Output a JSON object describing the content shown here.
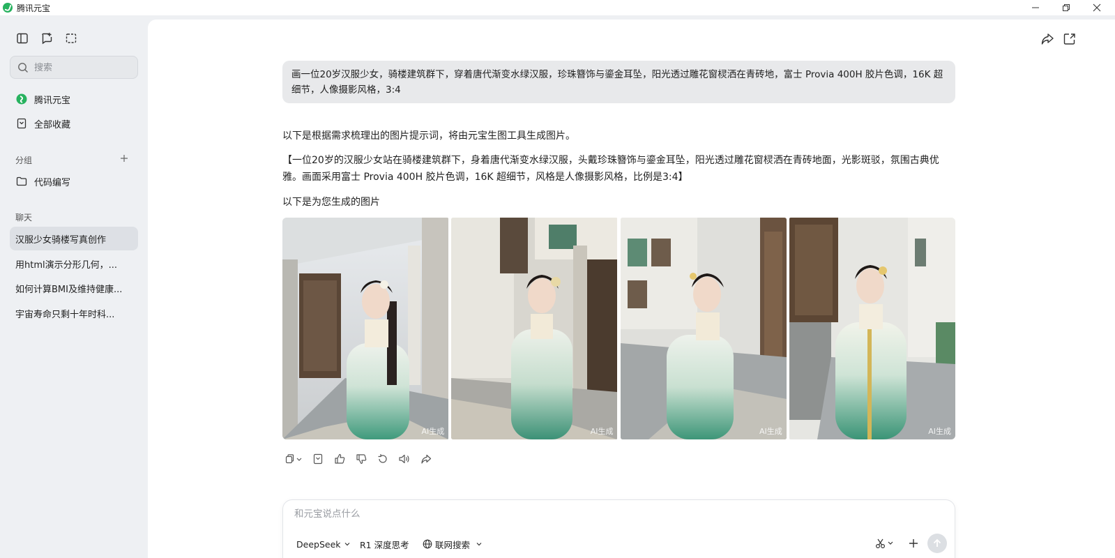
{
  "window": {
    "title": "腾讯元宝"
  },
  "sidebar": {
    "search_placeholder": "搜索",
    "nav": [
      {
        "label": "腾讯元宝",
        "icon": "yuanbao-logo-icon"
      },
      {
        "label": "全部收藏",
        "icon": "bookmark-icon"
      }
    ],
    "groups_label": "分组",
    "groups": [
      {
        "label": "代码编写",
        "icon": "folder-icon"
      }
    ],
    "chats_label": "聊天",
    "chats": [
      {
        "label": "汉服少女骑楼写真创作",
        "active": true
      },
      {
        "label": "用html演示分形几何，...",
        "active": false
      },
      {
        "label": "如何计算BMI及维持健康...",
        "active": false
      },
      {
        "label": "宇宙寿命只剩十年时科...",
        "active": false
      }
    ]
  },
  "conversation": {
    "user_message": "画一位20岁汉服少女，骑楼建筑群下，穿着唐代渐变水绿汉服，珍珠簪饰与鎏金耳坠，阳光透过雕花窗棂洒在青砖地，富士 Provia 400H 胶片色调，16K 超细节，人像摄影风格，3:4",
    "assistant": {
      "intro": "以下是根据需求梳理出的图片提示词，将由元宝生图工具生成图片。",
      "prompt": "【一位20岁的汉服少女站在骑楼建筑群下，身着唐代渐变水绿汉服，头戴珍珠簪饰与鎏金耳坠，阳光透过雕花窗棂洒在青砖地面，光影斑驳，氛围古典优雅。画面采用富士 Provia 400H 胶片色调，16K 超细节，风格是人像摄影风格，比例是3:4】",
      "generated_label": "以下是为您生成的图片",
      "images": [
        {
          "watermark": "AI生成"
        },
        {
          "watermark": "AI生成"
        },
        {
          "watermark": "AI生成"
        },
        {
          "watermark": "AI生成"
        }
      ]
    }
  },
  "composer": {
    "placeholder": "和元宝说点什么",
    "model": "DeepSeek",
    "deep_think": "R1 深度思考",
    "web_search": "联网搜索"
  },
  "colors": {
    "accent_green": "#27b25f",
    "sidebar_bg": "#eef0f3",
    "active_item_bg": "#dde0e5",
    "user_bubble_bg": "#e8e9eb",
    "hanfu_green": "#3f9a7c"
  }
}
